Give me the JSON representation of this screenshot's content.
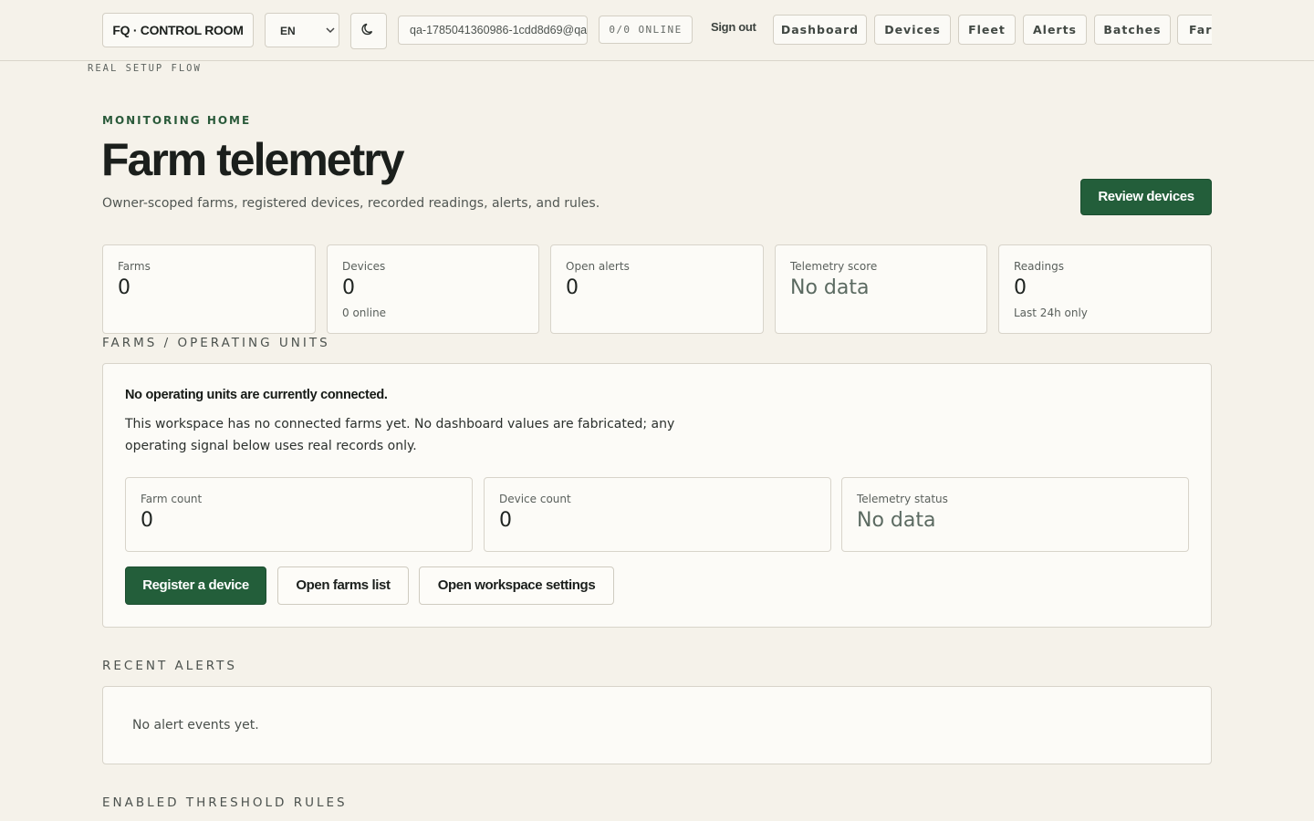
{
  "header": {
    "brand": "FQ · CONTROL ROOM",
    "language": "EN",
    "user_email": "qa-1785041360986-1cdd8d69@qa",
    "online_status": "0/0 ONLINE",
    "sign_out": "Sign out",
    "nav": [
      "Dashboard",
      "Devices",
      "Fleet",
      "Alerts",
      "Batches",
      "Farms"
    ]
  },
  "setup_label": "REAL SETUP FLOW",
  "hero": {
    "eyebrow": "MONITORING HOME",
    "title": "Farm telemetry",
    "subtitle": "Owner-scoped farms, registered devices, recorded readings, alerts, and rules.",
    "cta": "Review devices"
  },
  "stats": [
    {
      "label": "Farms",
      "value": "0",
      "note": ""
    },
    {
      "label": "Devices",
      "value": "0",
      "note": "0 online"
    },
    {
      "label": "Open alerts",
      "value": "0",
      "note": ""
    },
    {
      "label": "Telemetry score",
      "value": "No data",
      "note": ""
    },
    {
      "label": "Readings",
      "value": "0",
      "note": "Last 24h only"
    }
  ],
  "units": {
    "heading": "FARMS / OPERATING UNITS",
    "title": "No operating units are currently connected.",
    "body": "This workspace has no connected farms yet. No dashboard values are fabricated; any operating signal below uses real records only.",
    "metrics": [
      {
        "label": "Farm count",
        "value": "0"
      },
      {
        "label": "Device count",
        "value": "0"
      },
      {
        "label": "Telemetry status",
        "value": "No data"
      }
    ],
    "actions": {
      "register": "Register a device",
      "farms": "Open farms list",
      "settings": "Open workspace settings"
    }
  },
  "recent_alerts": {
    "heading": "RECENT ALERTS",
    "empty": "No alert events yet."
  },
  "threshold_rules": {
    "heading": "ENABLED THRESHOLD RULES"
  }
}
